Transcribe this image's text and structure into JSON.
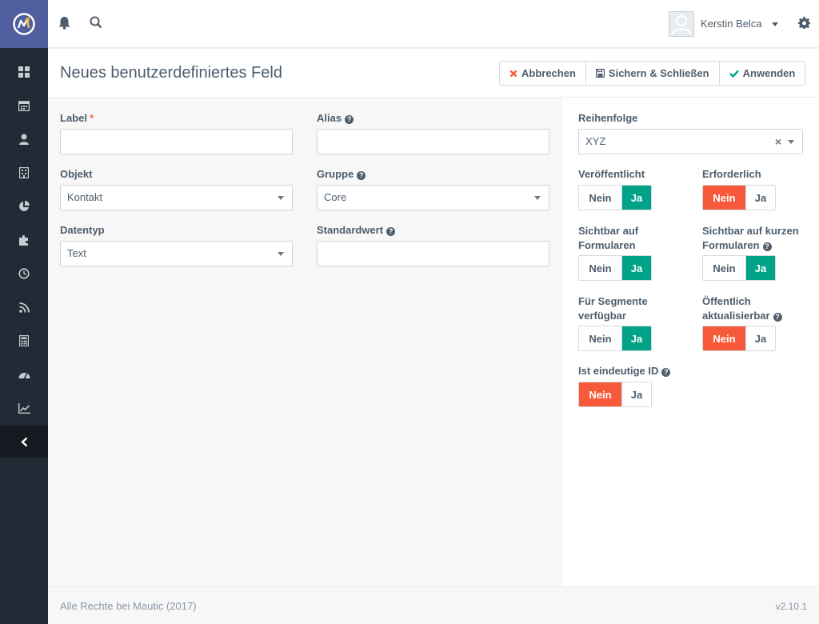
{
  "header": {
    "username": "Kerstin Belca"
  },
  "page": {
    "title": "Neues benutzerdefiniertes Feld",
    "buttons": {
      "cancel": "Abbrechen",
      "save_close": "Sichern & Schließen",
      "apply": "Anwenden"
    }
  },
  "form": {
    "label": {
      "label": "Label",
      "required_mark": "*",
      "value": ""
    },
    "alias": {
      "label": "Alias",
      "value": ""
    },
    "object": {
      "label": "Objekt",
      "value": "Kontakt"
    },
    "group": {
      "label": "Gruppe",
      "value": "Core"
    },
    "datatype": {
      "label": "Datentyp",
      "value": "Text"
    },
    "default_value": {
      "label": "Standardwert",
      "value": ""
    }
  },
  "settings": {
    "order": {
      "label": "Reihenfolge",
      "value": "XYZ",
      "clear": "×"
    },
    "no_label": "Nein",
    "yes_label": "Ja",
    "published": {
      "label": "Veröffentlicht",
      "value": "Ja"
    },
    "required": {
      "label": "Erforderlich",
      "value": "Nein"
    },
    "visible_forms": {
      "label_line1": "Sichtbar auf",
      "label_line2": "Formularen",
      "value": "Ja"
    },
    "visible_short_forms": {
      "label_line1": "Sichtbar auf kurzen",
      "label_line2": "Formularen",
      "value": "Ja"
    },
    "segments": {
      "label_line1": "Für Segmente",
      "label_line2": "verfügbar",
      "value": "Ja"
    },
    "public_update": {
      "label_line1": "Öffentlich",
      "label_line2": "aktualisierbar",
      "value": "Nein"
    },
    "unique_id": {
      "label": "Ist eindeutige ID",
      "value": "Nein"
    }
  },
  "footer": {
    "copyright": "Alle Rechte bei Mautic (2017)",
    "version": "v2.10.1"
  },
  "colors": {
    "sidebar": "#222b35",
    "brand": "#4e5e9e",
    "yes_active": "#00a388",
    "no_active": "#f75a3a",
    "accent": "#fdb933"
  }
}
